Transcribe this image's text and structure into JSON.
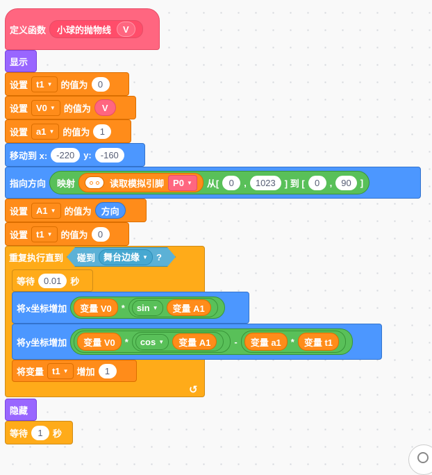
{
  "define": {
    "label": "定义函数",
    "name": "小球的抛物线",
    "param": "V"
  },
  "show": {
    "label": "显示"
  },
  "set_t1": {
    "label": "设置",
    "var": "t1",
    "suffix": "的值为",
    "value": "0"
  },
  "set_v0": {
    "label": "设置",
    "var": "V0",
    "suffix": "的值为",
    "value": "V"
  },
  "set_a1": {
    "label": "设置",
    "var": "a1",
    "suffix": "的值为",
    "value": "1"
  },
  "move_to": {
    "label": "移动到 x:",
    "x": "-220",
    "ylabel": "y:",
    "y": "-160"
  },
  "point": {
    "label": "指向方向",
    "map": "映射",
    "read": "读取模拟引脚",
    "pin": "P0",
    "from": "从[",
    "a": "0",
    "comma1": ",",
    "b": "1023",
    "to": "] 到 [",
    "c": "0",
    "comma2": ",",
    "d": "90",
    "close": "]"
  },
  "set_A1": {
    "label": "设置",
    "var": "A1",
    "suffix": "的值为",
    "value": "方向"
  },
  "set_t1b": {
    "label": "设置",
    "var": "t1",
    "suffix": "的值为",
    "value": "0"
  },
  "repeat": {
    "label": "重复执行直到",
    "touch": "碰到",
    "target": "舞台边缘",
    "q": "?"
  },
  "wait_inner": {
    "label": "等待",
    "value": "0.01",
    "unit": "秒"
  },
  "change_x": {
    "label": "将x坐标增加",
    "var1": "变量 V0",
    "op": "*",
    "fn": "sin",
    "var2": "变量 A1"
  },
  "change_y": {
    "label": "将y坐标增加",
    "var1": "变量 V0",
    "op1": "*",
    "fn": "cos",
    "var2": "变量 A1",
    "op2": "-",
    "var3": "变量 a1",
    "op3": "*",
    "var4": "变量 t1"
  },
  "change_var": {
    "label": "将变量",
    "var": "t1",
    "mid": "增加",
    "value": "1"
  },
  "loop_icon": "↺",
  "hide": {
    "label": "隐藏"
  },
  "wait_outer": {
    "label": "等待",
    "value": "1",
    "unit": "秒"
  },
  "dropdown_arrow": "▼",
  "colors": {
    "pink": "#ff6680",
    "purple": "#9966ff",
    "orange": "#ff8c1a",
    "blue": "#4c97ff",
    "yellow": "#ffab19",
    "green": "#59c059",
    "cyan": "#5cb1d6"
  }
}
